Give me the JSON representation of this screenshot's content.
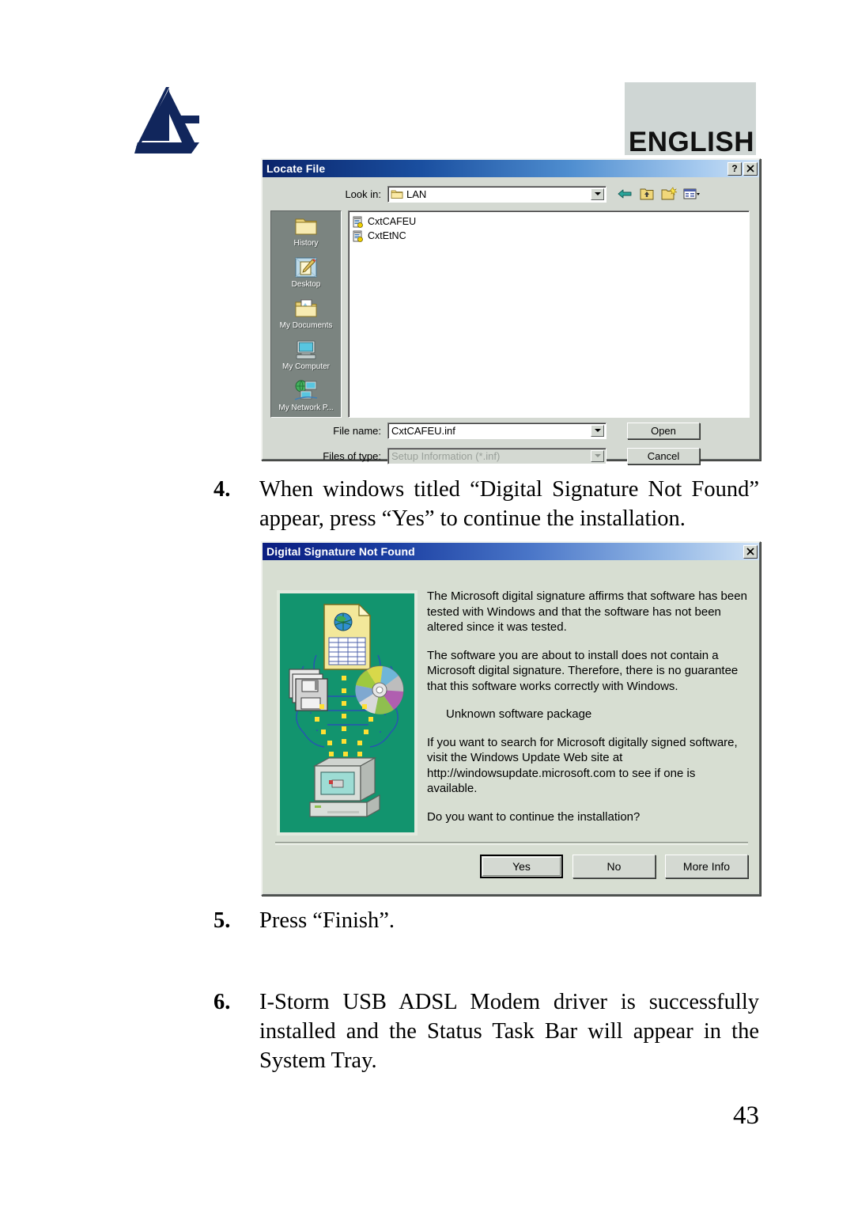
{
  "header": {
    "logo_name": "atlantis-land-logo",
    "banner_label": "ENGLISH"
  },
  "locate_file_dialog": {
    "title": "Locate File",
    "help_button": "?",
    "close_button": "✕",
    "look_in_label": "Look in:",
    "look_in_value": "LAN",
    "toolbar_icons": [
      "back-arrow-icon",
      "up-one-level-icon",
      "new-folder-icon",
      "views-icon"
    ],
    "places": [
      {
        "label": "History",
        "icon": "history-folder-icon"
      },
      {
        "label": "Desktop",
        "icon": "desktop-icon"
      },
      {
        "label": "My Documents",
        "icon": "my-documents-icon"
      },
      {
        "label": "My Computer",
        "icon": "my-computer-icon"
      },
      {
        "label": "My Network P...",
        "icon": "my-network-places-icon"
      }
    ],
    "files": [
      {
        "name": "CxtCAFEU",
        "icon": "inf-file-icon"
      },
      {
        "name": "CxtEtNC",
        "icon": "inf-file-icon"
      }
    ],
    "file_name_label": "File name:",
    "file_name_value": "CxtCAFEU.inf",
    "files_of_type_label": "Files of type:",
    "files_of_type_value": "Setup Information (*.inf)",
    "open_button": "Open",
    "cancel_button": "Cancel"
  },
  "steps": {
    "four": {
      "number": "4.",
      "text": "When windows titled “Digital Signature Not Found” appear, press “Yes” to continue the installation."
    },
    "five": {
      "number": "5.",
      "text": "Press “Finish”."
    },
    "six": {
      "number": "6.",
      "text": "I-Storm USB ADSL Modem driver is successfully installed and the Status Task Bar will appear in the System Tray."
    }
  },
  "digital_signature_dialog": {
    "title": "Digital Signature Not Found",
    "close_button": "✕",
    "illustration": "digital-signature-illustration",
    "paragraph_1": "The Microsoft digital signature affirms that software has been tested with Windows and that the software has not been altered since it was tested.",
    "paragraph_2": "The software you are about to install does not contain a Microsoft digital signature. Therefore,  there is no guarantee that this software works correctly with Windows.",
    "package_name": "Unknown software package",
    "paragraph_3": "If you want to search for Microsoft digitally signed software, visit the Windows Update Web site at http://windowsupdate.microsoft.com to see if one is available.",
    "question": "Do you want to continue the installation?",
    "yes_button": "Yes",
    "no_button": "No",
    "more_info_button": "More Info"
  },
  "footer": {
    "page_number": "43"
  },
  "colors": {
    "logo_navy": "#11265c",
    "banner_bg": "#cfd6d4",
    "dialog_face": "#d4d9d2",
    "titlebar_blue": "#0a246a",
    "illustration_green": "#12946e"
  }
}
